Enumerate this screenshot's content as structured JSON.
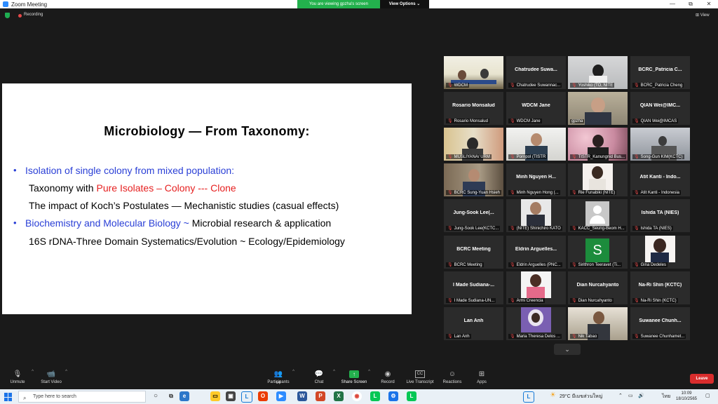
{
  "window": {
    "title": "Zoom Meeting",
    "minimize": "—",
    "maximize": "⧉",
    "close": "✕"
  },
  "banner": {
    "viewing": "You are viewing gpzha's screen",
    "view_options": "View Options ⌄"
  },
  "top": {
    "recording": "Recording",
    "view": "⊞ View"
  },
  "slide": {
    "title": "Microbiology — From Taxonomy:",
    "bullet1": "Isolation of single colony from mixed population:",
    "line2_prefix": "Taxonomy with ",
    "line2_red": "Pure Isolates – Colony --- Clone",
    "line3": "The impact of Koch’s Postulates — Mechanistic studies (casual effects)",
    "bullet2_blue": "Biochemistry and Molecular Biology ~ ",
    "bullet2_rest": "Microbial research & application",
    "line5": "16S rDNA-Three Domain Systematics/Evolution ~ Ecology/Epidemiology"
  },
  "participants": [
    {
      "center": "",
      "foot": "WDCM"
    },
    {
      "center": "Chatrudee Suwa...",
      "foot": "Chatrudee Suwannac..."
    },
    {
      "center": "",
      "foot": "Yoshiko (TO, NITE"
    },
    {
      "center": "BCRC_Patricia C...",
      "foot": "BCRC_Patricia Cheng"
    },
    {
      "center": "Rosario Monsalud",
      "foot": "Rosario Monsalud"
    },
    {
      "center": "WDCM Jane",
      "foot": "WDCM Jane"
    },
    {
      "center": "",
      "foot": "gpzha"
    },
    {
      "center": "QIAN Wei@IMC...",
      "foot": "QIAN Wei@IMCAS"
    },
    {
      "center": "",
      "foot": "MUSLIYANA/ URM"
    },
    {
      "center": "",
      "foot": "Pornpol (TISTR"
    },
    {
      "center": "",
      "foot": "TISTR_Kanungnid Bus..."
    },
    {
      "center": "",
      "foot": "Song-Gun KIM(KCTC)"
    },
    {
      "center": "",
      "foot": "BCRC Sung-Yuan Hsieh"
    },
    {
      "center": "Minh Nguyen H...",
      "foot": "Minh Nguyen Hong (..."
    },
    {
      "center": "",
      "foot": "Rie Funabiki (NITE)"
    },
    {
      "center": "Atit Kanti - Indo...",
      "foot": "Atit Kanti - Indonesia"
    },
    {
      "center": "Jung-Sook Lee(...",
      "foot": "Jung-Sook Lee(KCTC..."
    },
    {
      "center": "",
      "foot": "(NITE) Shinichiro KATO"
    },
    {
      "center": "",
      "foot": "KACC_Seung-Beom H..."
    },
    {
      "center": "Ishida TA (NIES)",
      "foot": "Ishida TA (NIES)"
    },
    {
      "center": "BCRC Meeting",
      "foot": "BCRC Meeting"
    },
    {
      "center": "Eldrin Arguelles...",
      "foot": "Eldrin Arguelles (PNC..."
    },
    {
      "center": "",
      "foot": "Sirithron Teeravet (Ti..."
    },
    {
      "center": "",
      "foot": "Gina Dedeles"
    },
    {
      "center": "I Made Sudiana-...",
      "foot": "I Made Sudiana-UN..."
    },
    {
      "center": "",
      "foot": "Armi Creencia"
    },
    {
      "center": "Dian Nurcahyanto",
      "foot": "Dian Nurcahyanto"
    },
    {
      "center": "Na-Ri Shin (KCTC)",
      "foot": "Na-Ri Shin (KCTC)"
    },
    {
      "center": "Lan Anh",
      "foot": "Lan Anh"
    },
    {
      "center": "",
      "foot": "Maria Theresa Delos ..."
    },
    {
      "center": "",
      "foot": "Nik Tabao"
    },
    {
      "center": "Suwanee Chunh...",
      "foot": "Suwanee Chunhamet..."
    }
  ],
  "avatar_letter": "S",
  "toolbar": {
    "unmute": "Unmute",
    "start_video": "Start Video",
    "participants": "Participants",
    "participants_count": "64",
    "chat": "Chat",
    "share": "Share Screen",
    "record": "Record",
    "transcript": "Live Transcript",
    "reactions": "Reactions",
    "apps": "Apps",
    "leave": "Leave"
  },
  "taskbar": {
    "search_placeholder": "Type here to search",
    "weather": "29°C  มีเมฆส่วนใหญ่",
    "lang": "ไทย",
    "time": "10:09",
    "date": "18/10/2565"
  },
  "colors": {
    "accent_green": "#23b14d",
    "leave_red": "#d92d2d",
    "slide_blue": "#2a3fd6",
    "slide_red": "#e62020"
  }
}
